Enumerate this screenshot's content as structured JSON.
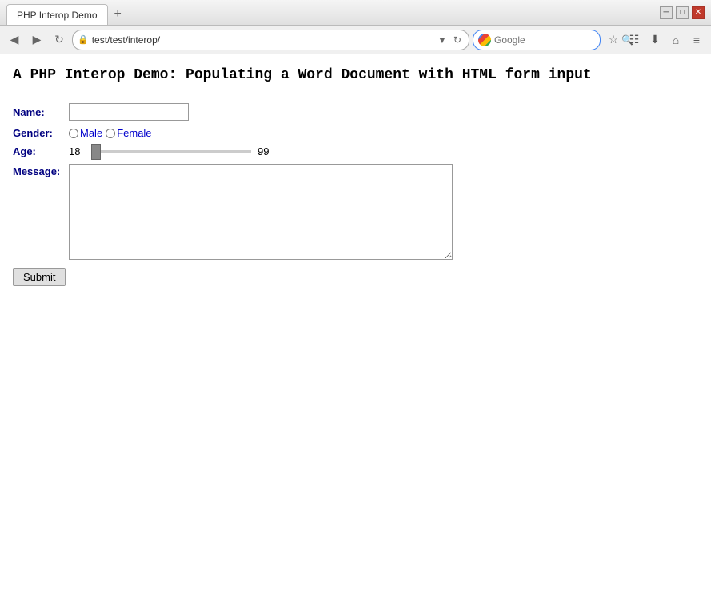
{
  "window": {
    "title": "PHP Interop Demo",
    "tab_label": "PHP Interop Demo",
    "tab_new_label": "+",
    "controls": {
      "minimize": "─",
      "maximize": "□",
      "close": "✕"
    }
  },
  "navbar": {
    "back_label": "◀",
    "forward_label": "▶",
    "refresh_label": "↻",
    "home_label": "⌂",
    "address": "test/test/interop/",
    "address_placeholder": "test/test/interop/",
    "search_placeholder": "Google",
    "dropdown_label": "▼",
    "tools": {
      "star": "☆",
      "bookmark": "☷",
      "download": "⬇",
      "home2": "⌂",
      "menu": "≡"
    }
  },
  "page": {
    "title": "A PHP Interop Demo: Populating a Word Document with HTML form input",
    "form": {
      "name_label": "Name:",
      "name_placeholder": "",
      "gender_label": "Gender:",
      "gender_options": [
        "Male",
        "Female"
      ],
      "age_label": "Age:",
      "age_min": "18",
      "age_max": "99",
      "age_default": 18,
      "message_label": "Message:",
      "submit_label": "Submit"
    }
  }
}
